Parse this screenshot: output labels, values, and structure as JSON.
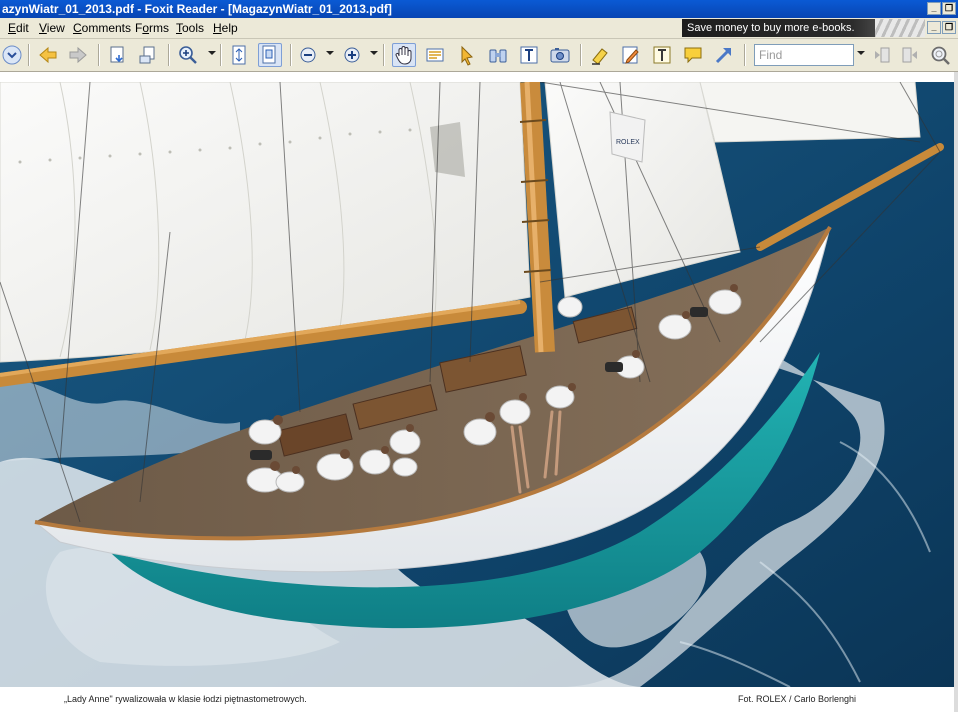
{
  "window": {
    "title": "azynWiatr_01_2013.pdf - Foxit Reader - [MagazynWiatr_01_2013.pdf]",
    "minimize": "_",
    "restore": "❐",
    "close": "✕"
  },
  "menu": {
    "items": [
      {
        "key": "E",
        "rest": "dit"
      },
      {
        "key": "V",
        "rest": "iew"
      },
      {
        "key": "C",
        "rest": "omments"
      },
      {
        "key": "F",
        "rest": "orms",
        "pre": "F",
        "under": "o",
        "post": "rms"
      },
      {
        "key": "T",
        "rest": "ools"
      },
      {
        "key": "H",
        "rest": "elp"
      }
    ],
    "ad_text": "Save money to buy more e-books."
  },
  "toolbar": {
    "find_placeholder": "Find"
  },
  "document": {
    "caption_left": "„Lady Anne\" rywalizowała w klasie łodzi piętnastometrowych.",
    "caption_right": "Fot. ROLEX / Carlo Borlenghi",
    "flag_text": "ROLEX"
  },
  "colors": {
    "title_blue": "#0a5ad4",
    "chrome": "#ece9d8",
    "sea_deep": "#0e3f66",
    "hull_turquoise": "#1aa7a8"
  }
}
